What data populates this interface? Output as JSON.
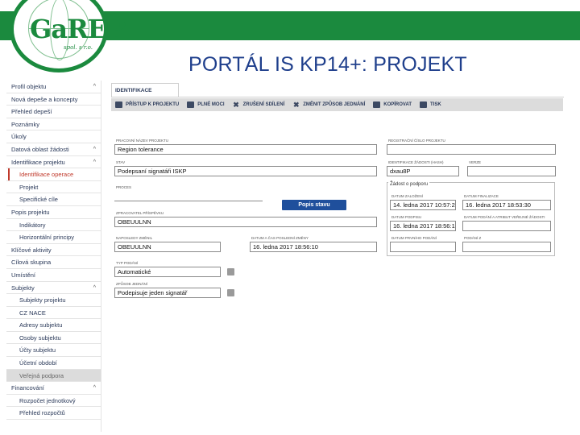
{
  "logo": {
    "text": "GaREP",
    "sub": "spol. s r.o."
  },
  "slide_title": "PORTÁL IS KP14+: PROJEKT",
  "colors": {
    "brand_green": "#1b8a3e",
    "title_blue": "#1f3f8c",
    "button_blue": "#1f4f9c",
    "active_red": "#c0392b"
  },
  "sidebar": {
    "items": [
      {
        "label": "Profil objektu",
        "level": 0,
        "chevron": "^"
      },
      {
        "label": "Nová depeše a koncepty",
        "level": 0
      },
      {
        "label": "Přehled depeší",
        "level": 0
      },
      {
        "label": "Poznámky",
        "level": 0
      },
      {
        "label": "Úkoly",
        "level": 0
      },
      {
        "label": "Datová oblast žádosti",
        "level": 0,
        "chevron": "^"
      },
      {
        "label": "Identifikace projektu",
        "level": 0,
        "chevron": "^"
      },
      {
        "label": "Identifikace operace",
        "level": 1,
        "active": true
      },
      {
        "label": "Projekt",
        "level": 1
      },
      {
        "label": "Specifické cíle",
        "level": 1
      },
      {
        "label": "Popis projektu",
        "level": 0
      },
      {
        "label": "Indikátory",
        "level": 1
      },
      {
        "label": "Horizontální principy",
        "level": 1
      },
      {
        "label": "Klíčové aktivity",
        "level": 0
      },
      {
        "label": "Cílová skupina",
        "level": 0
      },
      {
        "label": "Umístění",
        "level": 0
      },
      {
        "label": "Subjekty",
        "level": 0,
        "chevron": "^"
      },
      {
        "label": "Subjekty projektu",
        "level": 1
      },
      {
        "label": "CZ NACE",
        "level": 1
      },
      {
        "label": "Adresy subjektu",
        "level": 1
      },
      {
        "label": "Osoby subjektu",
        "level": 1
      },
      {
        "label": "Účty subjektu",
        "level": 1
      },
      {
        "label": "Účetní období",
        "level": 1
      },
      {
        "label": "Veřejná podpora",
        "level": 1,
        "highlighted": true
      },
      {
        "label": "Financování",
        "level": 0,
        "chevron": "^"
      },
      {
        "label": "Rozpočet jednotkový",
        "level": 1
      },
      {
        "label": "Přehled rozpočtů",
        "level": 1
      }
    ]
  },
  "tab": {
    "label": "IDENTIFIKACE OPERACE"
  },
  "toolbar": {
    "buttons": [
      {
        "label": "PŘÍSTUP K PROJEKTU",
        "icon": "key-icon"
      },
      {
        "label": "PLNÉ MOCI",
        "icon": "envelope-icon"
      },
      {
        "label": "ZRUŠENÍ SDÍLENÍ",
        "icon": "close-icon"
      },
      {
        "label": "ZMĚNIT ZPŮSOB JEDNÁNÍ",
        "icon": "close-icon"
      },
      {
        "label": "KOPÍROVAT",
        "icon": "copy-icon"
      },
      {
        "label": "TISK",
        "icon": "print-icon"
      }
    ]
  },
  "form": {
    "label_pracovni_nazev": "PRACOVNÍ NÁZEV PROJEKTU",
    "pracovni_nazev": "Region tolerance",
    "label_registracni_cislo": "REGISTRAČNÍ ČÍSLO PROJEKTU",
    "registracni_cislo": "",
    "label_stav": "STAV",
    "stav": "Podepsaní signatáři ISKP",
    "label_hash": "IDENTIFIKACE ŽÁDOSTI (HASH)",
    "hash": "dxau8P",
    "label_verze": "VERZE",
    "verze": "",
    "label_proces": "PROCES",
    "button_popis_stavu": "Popis stavu",
    "label_zpracoval": "ZPRACOVATEL PŘÍSPĚVKU",
    "zpracoval": "OBEUULNN",
    "label_naposledy_zmenil": "NAPOSLEDY ZMĚNIL",
    "naposledy_zmenil": "OBEUULNN",
    "label_datum_zmeny": "DATUM A ČAS POSLEDNÍ ZMĚNY",
    "datum_zmeny": "16. ledna 2017 18:56:10",
    "label_typ_podani": "TYP PODÁNÍ",
    "typ_podani": "Automatické",
    "label_zpusob_jednani": "ZPŮSOB JEDNÁNÍ",
    "zpusob_jednani": "Podepisuje jeden signatář"
  },
  "signature_box": {
    "title": "Žádost o podporu",
    "label_datum_zalozeni": "DATUM ZALOŽENÍ",
    "datum_zalozeni": "14. ledna 2017 10:57:24",
    "label_datum_finalizace": "DATUM FINALIZACE",
    "datum_finalizace": "16. ledna 2017 18:53:30",
    "label_datum_podpisu": "DATUM PODPISU",
    "datum_podpisu": "16. ledna 2017 18:56:10",
    "label_datum_podani": "DATUM PODÁNÍ A ATRIBUT VEŘEJNÉ ŽÁDOSTI",
    "datum_podani": "",
    "label_prvni_podani": "DATUM PRVNÍHO PODÁNÍ",
    "prvni_podani": "",
    "label_podani_z": "PODÁNÍ Z",
    "podani_z": ""
  }
}
